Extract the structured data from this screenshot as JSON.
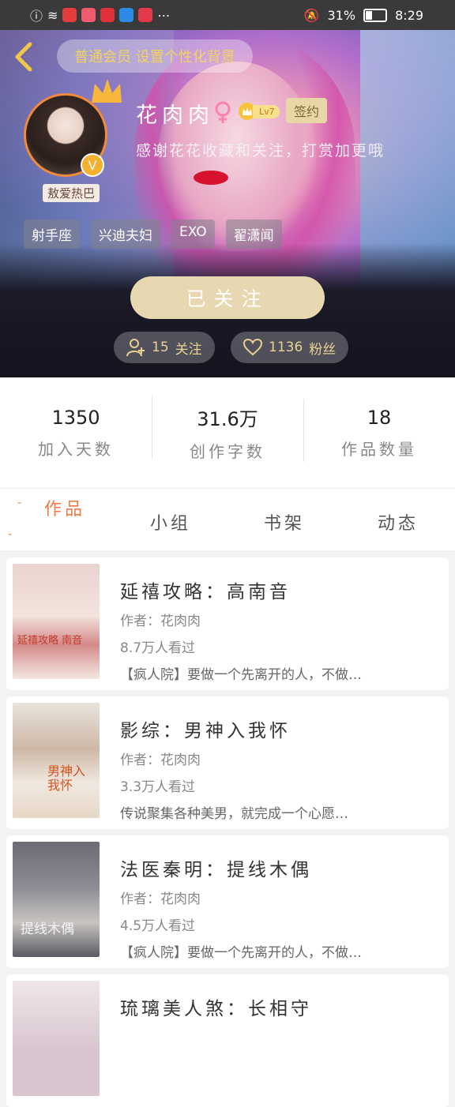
{
  "status_bar": {
    "battery": "31%",
    "time": "8:29"
  },
  "header": {
    "bg_setting_label": "普通会员 设置个性化背景"
  },
  "profile": {
    "avatar_caption": "敖爱热巴",
    "username": "花肉肉",
    "level": "Lv7",
    "contract_label": "签约",
    "bio": "感谢花花收藏和关注，打赏加更哦",
    "tags": [
      "射手座",
      "兴迪夫妇",
      "EXO",
      "翟潇闻"
    ],
    "follow_button": "已关注",
    "following": {
      "count": "15",
      "label": "关注"
    },
    "fans": {
      "count": "1136",
      "label": "粉丝"
    }
  },
  "stats": [
    {
      "value": "1350",
      "label": "加入天数"
    },
    {
      "value": "31.6万",
      "label": "创作字数"
    },
    {
      "value": "18",
      "label": "作品数量"
    }
  ],
  "tabs": [
    "作品",
    "小组",
    "书架",
    "动态"
  ],
  "works": [
    {
      "title": "延禧攻略：高南音",
      "author": "作者：花肉肉",
      "views": "8.7万人看过",
      "desc": "【疯人院】要做一个先离开的人，不做…",
      "cover_text": "延禧攻略 南音"
    },
    {
      "title": "影综：男神入我怀",
      "author": "作者：花肉肉",
      "views": "3.3万人看过",
      "desc": "传说聚集各种美男，就完成一个心愿…",
      "cover_text": "男神入我怀"
    },
    {
      "title": "法医秦明：提线木偶",
      "author": "作者：花肉肉",
      "views": "4.5万人看过",
      "desc": "【疯人院】要做一个先离开的人，不做…",
      "cover_text": "提线木偶"
    },
    {
      "title": "琉璃美人煞：长相守",
      "author": "",
      "views": "",
      "desc": "",
      "cover_text": ""
    }
  ]
}
